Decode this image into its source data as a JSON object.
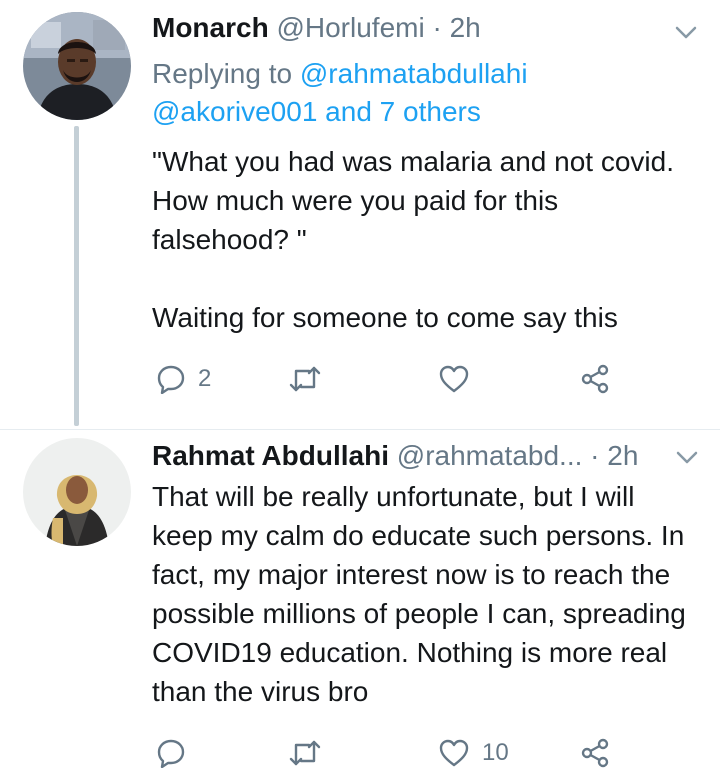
{
  "tweets": [
    {
      "display_name": "Monarch",
      "handle": "@Horlufemi",
      "separator": "·",
      "time": "2h",
      "replying_prefix": "Replying to",
      "replying_mention_1": "@rahmatabdullahi",
      "replying_mention_2": "@akorive001 and 7 others",
      "text_line_1": "\"What you had was malaria and not covid. How much were you paid for this falsehood? \"",
      "text_line_2": "Waiting for someone to come say this",
      "reply_count": "2",
      "retweet_count": "",
      "like_count": ""
    },
    {
      "display_name": "Rahmat Abdullahi",
      "handle": "@rahmatabd...",
      "separator": "·",
      "time": "2h",
      "text_line_1": "That will be really unfortunate, but I will keep my calm do educate such persons. In fact, my major interest now is to reach the possible millions of people I can, spreading COVID19 education. Nothing is more real than the virus bro",
      "reply_count": "",
      "retweet_count": "",
      "like_count": "10"
    }
  ],
  "icons": {
    "reply": "reply-icon",
    "retweet": "retweet-icon",
    "like": "heart-icon",
    "share": "share-icon",
    "menu": "chevron-down-icon"
  },
  "colors": {
    "text": "#14171a",
    "secondary": "#657786",
    "link": "#1da1f2",
    "thread_line": "#c4cfd6"
  }
}
